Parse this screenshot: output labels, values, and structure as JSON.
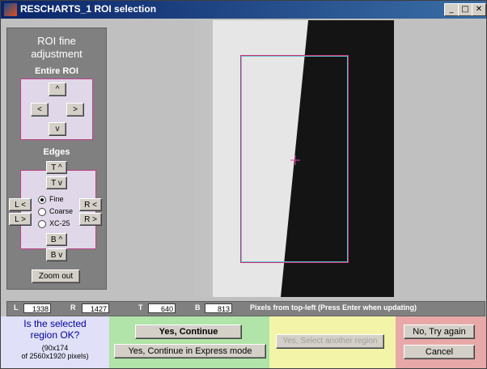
{
  "window": {
    "title": "RESCHARTS_1 ROI selection"
  },
  "title_buttons": {
    "minimize": "_",
    "maximize": "□",
    "close": "✕"
  },
  "panel": {
    "title_line1": "ROI fine",
    "title_line2": "adjustment",
    "entire_roi_label": "Entire ROI",
    "up": "^",
    "left": "<",
    "right": ">",
    "down": "v",
    "edges_label": "Edges",
    "t_up": "T ^",
    "t_down": "T v",
    "l_left": "L <",
    "l_right": "L >",
    "r_left": "R <",
    "r_right": "R >",
    "b_up": "B ^",
    "b_down": "B v",
    "radio": [
      "Fine",
      "Coarse",
      "XC-25"
    ],
    "radio_selected": "Fine",
    "zoom_out": "Zoom out"
  },
  "coords": {
    "L_label": "L",
    "L": "1338",
    "R_label": "R",
    "R": "1427",
    "T_label": "T",
    "T": "640",
    "B_label": "B",
    "B": "813",
    "hint": "Pixels from top-left  (Press Enter when updating)"
  },
  "bottom": {
    "question_line1": "Is the selected",
    "question_line2": "region OK?",
    "size_line1": "(90x174",
    "size_line2": "of 2560x1920 pixels)",
    "yes_continue": "Yes, Continue",
    "yes_express": "Yes, Continue in Express mode",
    "yes_select_another": "Yes, Select another region",
    "no_try_again": "No, Try again",
    "cancel": "Cancel"
  },
  "colors": {
    "title_bar": "#0a246a",
    "panel_bg": "#808080",
    "roi_outer": "#d03070",
    "roi_inner": "#60c0d0",
    "question_bg": "#e0e0f8",
    "yes_bg": "#b0e4a8",
    "select_bg": "#f4f4a8",
    "no_bg": "#e8a8a8"
  }
}
